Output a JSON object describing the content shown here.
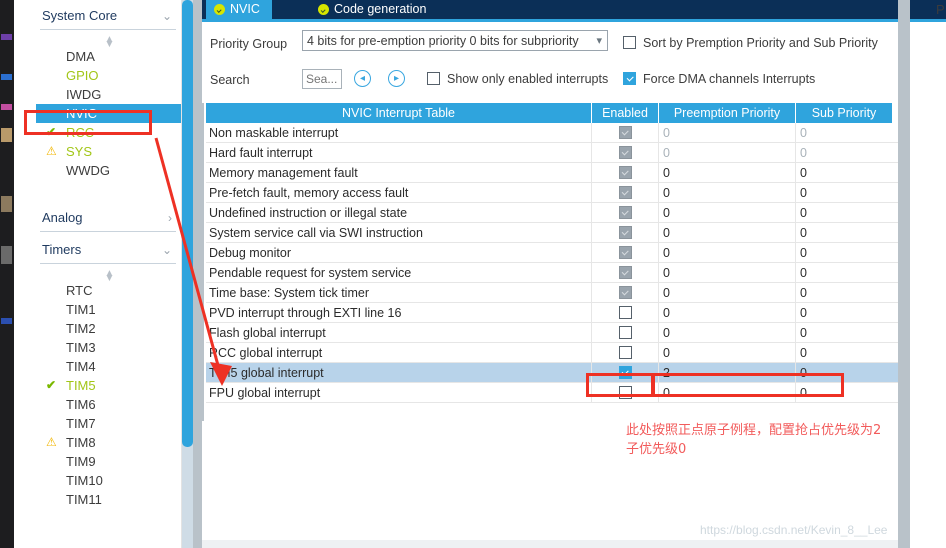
{
  "sidebar": {
    "groups": [
      {
        "label": "System Core",
        "items": [
          {
            "label": "DMA",
            "mark": "none",
            "style": "normal"
          },
          {
            "label": "GPIO",
            "mark": "none",
            "style": "green"
          },
          {
            "label": "IWDG",
            "mark": "none",
            "style": "normal"
          },
          {
            "label": "NVIC",
            "mark": "none",
            "style": "selected"
          },
          {
            "label": "RCC",
            "mark": "check",
            "style": "green"
          },
          {
            "label": "SYS",
            "mark": "warn",
            "style": "green"
          },
          {
            "label": "WWDG",
            "mark": "none",
            "style": "normal"
          }
        ]
      },
      {
        "label": "Analog",
        "items": []
      },
      {
        "label": "Timers",
        "items": [
          {
            "label": "RTC",
            "mark": "none",
            "style": "normal"
          },
          {
            "label": "TIM1",
            "mark": "none",
            "style": "normal"
          },
          {
            "label": "TIM2",
            "mark": "none",
            "style": "normal"
          },
          {
            "label": "TIM3",
            "mark": "none",
            "style": "normal"
          },
          {
            "label": "TIM4",
            "mark": "none",
            "style": "normal"
          },
          {
            "label": "TIM5",
            "mark": "check",
            "style": "green"
          },
          {
            "label": "TIM6",
            "mark": "none",
            "style": "normal"
          },
          {
            "label": "TIM7",
            "mark": "none",
            "style": "normal"
          },
          {
            "label": "TIM8",
            "mark": "warn",
            "style": "normal"
          },
          {
            "label": "TIM9",
            "mark": "none",
            "style": "normal"
          },
          {
            "label": "TIM10",
            "mark": "none",
            "style": "normal"
          },
          {
            "label": "TIM11",
            "mark": "none",
            "style": "normal"
          }
        ]
      }
    ]
  },
  "tabs": [
    {
      "label": "NVIC",
      "active": true
    },
    {
      "label": "Code generation",
      "active": false
    }
  ],
  "toolbar": {
    "priority_group_label": "Priority Group",
    "priority_group_value": "4 bits for pre-emption priority 0 bits for subpriority",
    "search_label": "Search",
    "search_value": "",
    "search_placeholder": "Sea...",
    "prev_button": "◂",
    "next_button": "▸",
    "sort_checkbox_label": "Sort by Premption Priority and Sub Priority",
    "sort_checkbox_checked": false,
    "show_enabled_label": "Show only enabled interrupts",
    "show_enabled_checked": false,
    "force_dma_label": "Force DMA channels Interrupts",
    "force_dma_checked": true
  },
  "table": {
    "columns": [
      "NVIC Interrupt Table",
      "Enabled",
      "Preemption Priority",
      "Sub Priority"
    ],
    "rows": [
      {
        "name": "Non maskable interrupt",
        "enabled": "disabled-checked",
        "preemption": "0",
        "sub": "0",
        "dim": true,
        "selected": false
      },
      {
        "name": "Hard fault interrupt",
        "enabled": "disabled-checked",
        "preemption": "0",
        "sub": "0",
        "dim": true,
        "selected": false
      },
      {
        "name": "Memory management fault",
        "enabled": "disabled-checked",
        "preemption": "0",
        "sub": "0",
        "dim": false,
        "selected": false
      },
      {
        "name": "Pre-fetch fault, memory access fault",
        "enabled": "disabled-checked",
        "preemption": "0",
        "sub": "0",
        "dim": false,
        "selected": false
      },
      {
        "name": "Undefined instruction or illegal state",
        "enabled": "disabled-checked",
        "preemption": "0",
        "sub": "0",
        "dim": false,
        "selected": false
      },
      {
        "name": "System service call via SWI instruction",
        "enabled": "disabled-checked",
        "preemption": "0",
        "sub": "0",
        "dim": false,
        "selected": false
      },
      {
        "name": "Debug monitor",
        "enabled": "disabled-checked",
        "preemption": "0",
        "sub": "0",
        "dim": false,
        "selected": false
      },
      {
        "name": "Pendable request for system service",
        "enabled": "disabled-checked",
        "preemption": "0",
        "sub": "0",
        "dim": false,
        "selected": false
      },
      {
        "name": "Time base: System tick timer",
        "enabled": "disabled-checked",
        "preemption": "0",
        "sub": "0",
        "dim": false,
        "selected": false
      },
      {
        "name": "PVD interrupt through EXTI line 16",
        "enabled": "unchecked",
        "preemption": "0",
        "sub": "0",
        "dim": false,
        "selected": false
      },
      {
        "name": "Flash global interrupt",
        "enabled": "unchecked",
        "preemption": "0",
        "sub": "0",
        "dim": false,
        "selected": false
      },
      {
        "name": "RCC global interrupt",
        "enabled": "unchecked",
        "preemption": "0",
        "sub": "0",
        "dim": false,
        "selected": false
      },
      {
        "name": "TIM5 global interrupt",
        "enabled": "checked",
        "preemption": "2",
        "sub": "0",
        "dim": false,
        "selected": true
      },
      {
        "name": "FPU global interrupt",
        "enabled": "unchecked",
        "preemption": "0",
        "sub": "0",
        "dim": false,
        "selected": false
      }
    ]
  },
  "annotations": {
    "note_line1": "此处按照正点原子例程，配置抢占优先级为2",
    "note_line2": "子优先级0",
    "red_color": "#ee3124",
    "note_color": "#f25b5b"
  },
  "watermark": "https://blog.csdn.net/Kevin_8__Lee",
  "right_edge_letter": "P"
}
